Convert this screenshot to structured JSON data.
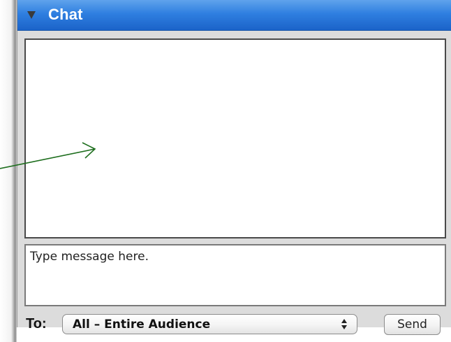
{
  "panel": {
    "title": "Chat",
    "collapse_icon": "triangle-down-icon"
  },
  "chat_log": {
    "messages": []
  },
  "message_input": {
    "placeholder": "Type message here."
  },
  "recipient": {
    "label": "To:",
    "selected": "All – Entire Audience",
    "icon": "select-arrows-icon"
  },
  "send_button": {
    "label": "Send"
  },
  "annotation": {
    "arrow_color": "#1e6e1e"
  },
  "colors": {
    "title_bar": "#2f7fe0",
    "panel_background": "#dcdcdc"
  }
}
